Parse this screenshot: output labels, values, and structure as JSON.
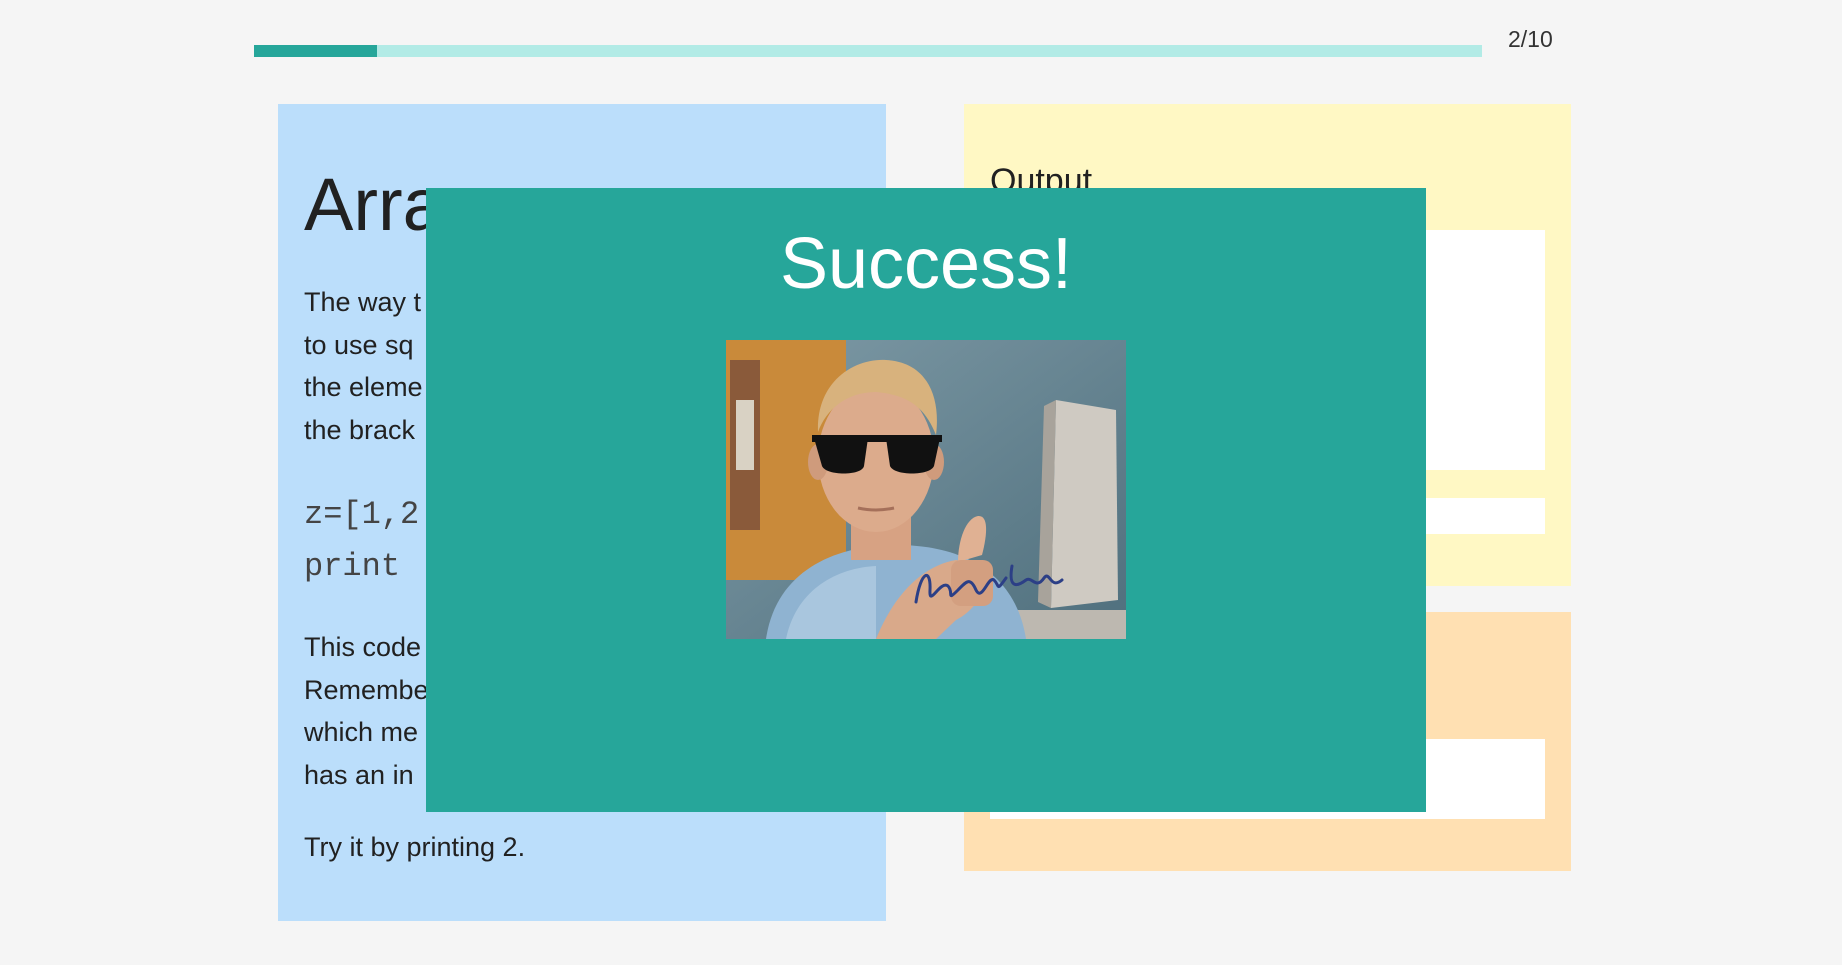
{
  "progress": {
    "label": "2/10",
    "fraction": 0.1
  },
  "lesson": {
    "title": "Arra",
    "paragraph1": [
      "The way t",
      "to use sq",
      "the eleme",
      "the brack"
    ],
    "code": [
      "z=[1,2",
      "print"
    ],
    "paragraph2": [
      "This code",
      "Remembe",
      "which me",
      "has an in"
    ],
    "paragraph3": "Try it by printing 2."
  },
  "output": {
    "title": "Output"
  },
  "modal": {
    "title": "Success!",
    "image_signature": "Brent Rambo"
  },
  "colors": {
    "background": "#f5f5f5",
    "progress_fill": "#26a69a",
    "progress_track": "#b2ebe6",
    "lesson_card": "#bbdefb",
    "output_card": "#fff8c4",
    "input_card": "#ffe0b2",
    "modal": "#26a69a"
  }
}
